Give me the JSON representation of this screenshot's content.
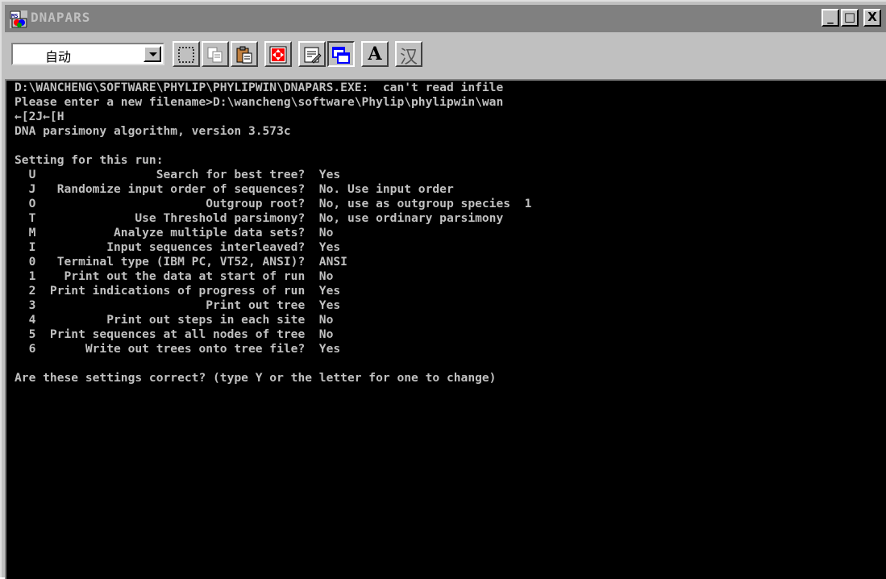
{
  "window": {
    "title": "DNAPARS",
    "minimize": "_",
    "maximize": "□",
    "close": "X"
  },
  "toolbar": {
    "font_select_value": "自动",
    "bold_font_label": "A",
    "ime_label": "汉"
  },
  "console": {
    "lines": [
      "D:\\WANCHENG\\SOFTWARE\\PHYLIP\\PHYLIPWIN\\DNAPARS.EXE:  can't read infile",
      "Please enter a new filename>D:\\wancheng\\software\\Phylip\\phylipwin\\wan",
      "←[2J←[H",
      "DNA parsimony algorithm, version 3.573c",
      "",
      "Setting for this run:",
      "  U                 Search for best tree?  Yes",
      "  J   Randomize input order of sequences?  No. Use input order",
      "  O                        Outgroup root?  No, use as outgroup species  1",
      "  T              Use Threshold parsimony?  No, use ordinary parsimony",
      "  M           Analyze multiple data sets?  No",
      "  I          Input sequences interleaved?  Yes",
      "  0   Terminal type (IBM PC, VT52, ANSI)?  ANSI",
      "  1    Print out the data at start of run  No",
      "  2  Print indications of progress of run  Yes",
      "  3                        Print out tree  Yes",
      "  4          Print out steps in each site  No",
      "  5  Print sequences at all nodes of tree  No",
      "  6       Write out trees onto tree file?  Yes",
      "",
      "Are these settings correct? (type Y or the letter for one to change)"
    ]
  }
}
